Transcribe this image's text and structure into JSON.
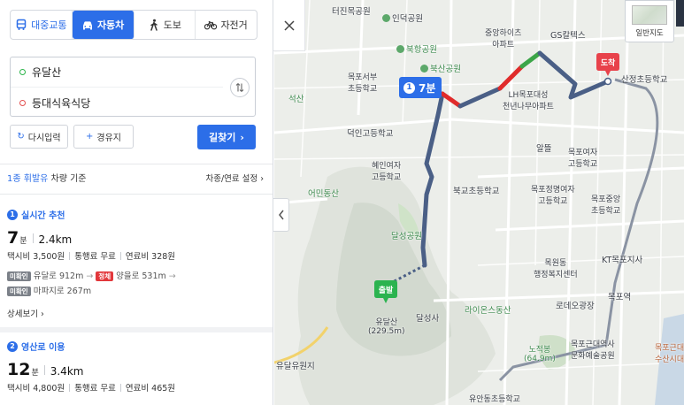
{
  "modes": [
    {
      "name": "transit",
      "label": "대중교통",
      "icon": "bus-icon"
    },
    {
      "name": "car",
      "label": "자동차",
      "icon": "car-icon",
      "active": true
    },
    {
      "name": "walk",
      "label": "도보",
      "icon": "walk-icon"
    },
    {
      "name": "bike",
      "label": "자전거",
      "icon": "bicycle-icon"
    }
  ],
  "route": {
    "origin": "유달산",
    "destination": "등대식육식당"
  },
  "buttons": {
    "reset": "다시입력",
    "via": "경유지",
    "find": "길찾기"
  },
  "vehicle": {
    "type_strong": "1종 휘발유",
    "type_rest": " 차량 기준",
    "settings": "차종/연료 설정"
  },
  "results": [
    {
      "index": "1",
      "title": "실시간 추천",
      "time": "7",
      "time_unit": "분",
      "distance": "2.4km",
      "taxi": "택시비 3,500원",
      "toll": "통행료 무료",
      "fuel": "연료비 328원",
      "roads_line1": {
        "badge1": "미확인",
        "road1": "유달로 912m",
        "badge2": "정체",
        "road2": "양을로 531m"
      },
      "roads_line2": {
        "badge1": "미확인",
        "road1": "마파지로 267m"
      },
      "detail": "상세보기"
    },
    {
      "index": "2",
      "title": "영산로 이용",
      "time": "12",
      "time_unit": "분",
      "distance": "3.4km",
      "taxi": "택시비 4,800원",
      "toll": "통행료 무료",
      "fuel": "연료비 465원"
    }
  ],
  "map": {
    "route_badge": {
      "index": "1",
      "time": "7분"
    },
    "start_pin": "출발",
    "end_pin": "도착",
    "view_toggle": "일반지도",
    "labels": {
      "l1": "터진목공원",
      "l2": "인덕공원",
      "l3": "중앙하이츠",
      "l3b": "아파트",
      "l4": "GS칼텍스",
      "l5": "목포서부",
      "l5b": "초등학교",
      "l6": "북항공원",
      "l7": "북산공원",
      "l8": "LH목포대성",
      "l8b": "천년나무아파트",
      "l9": "산정초등학교",
      "l10": "덕인고등학교",
      "l11": "혜인여자",
      "l11b": "고등학교",
      "l12": "어민동산",
      "l13": "알뜰",
      "l14": "목포여자",
      "l14b": "고등학교",
      "l15": "북교초등학교",
      "l16": "목포정명여자",
      "l16b": "고등학교",
      "l17": "목포중앙",
      "l17b": "초등학교",
      "l18": "달성공원",
      "l19": "KT목포지사",
      "l20": "목원동",
      "l20b": "행정복지센터",
      "l21": "라이온스동산",
      "l22": "목포역",
      "l23": "로데오광장",
      "l24": "유달산",
      "l24b": "(229.5m)",
      "l25": "달성사",
      "l26": "노적봉",
      "l26b": "(64.9m)",
      "l27": "목포근대역사",
      "l27b": "문화예술공원",
      "l28": "유달유원지",
      "l29": "유안동초등학교",
      "l30": "목포근대",
      "l30b": "수산시대",
      "l31": "석산"
    }
  }
}
